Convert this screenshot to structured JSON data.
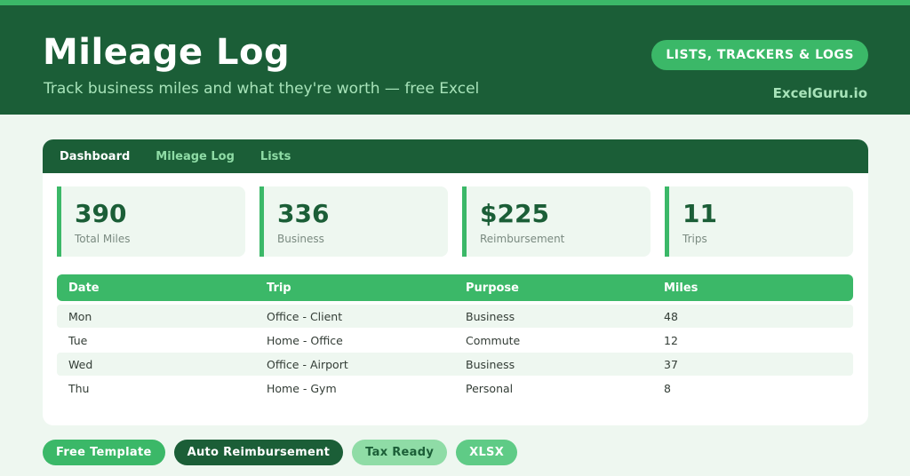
{
  "header": {
    "title": "Mileage Log",
    "subtitle": "Track business miles and what they're worth — free Excel",
    "category": "LISTS, TRACKERS & LOGS",
    "brand": "ExcelGuru.io"
  },
  "tabs": [
    {
      "label": "Dashboard",
      "active": true
    },
    {
      "label": "Mileage Log",
      "active": false
    },
    {
      "label": "Lists",
      "active": false
    }
  ],
  "kpis": [
    {
      "value": "390",
      "label": "Total Miles"
    },
    {
      "value": "336",
      "label": "Business"
    },
    {
      "value": "$225",
      "label": "Reimbursement"
    },
    {
      "value": "11",
      "label": "Trips"
    }
  ],
  "table": {
    "columns": [
      "Date",
      "Trip",
      "Purpose",
      "Miles"
    ],
    "rows": [
      [
        "Mon",
        "Office - Client",
        "Business",
        "48"
      ],
      [
        "Tue",
        "Home - Office",
        "Commute",
        "12"
      ],
      [
        "Wed",
        "Office - Airport",
        "Business",
        "37"
      ],
      [
        "Thu",
        "Home - Gym",
        "Personal",
        "8"
      ]
    ]
  },
  "tags": [
    "Free Template",
    "Auto Reimbursement",
    "Tax Ready",
    "XLSX"
  ],
  "colors": {
    "dark_green": "#1b5e37",
    "accent_green": "#3bb868",
    "light_green": "#8fdca6",
    "background": "#eef7f0"
  }
}
